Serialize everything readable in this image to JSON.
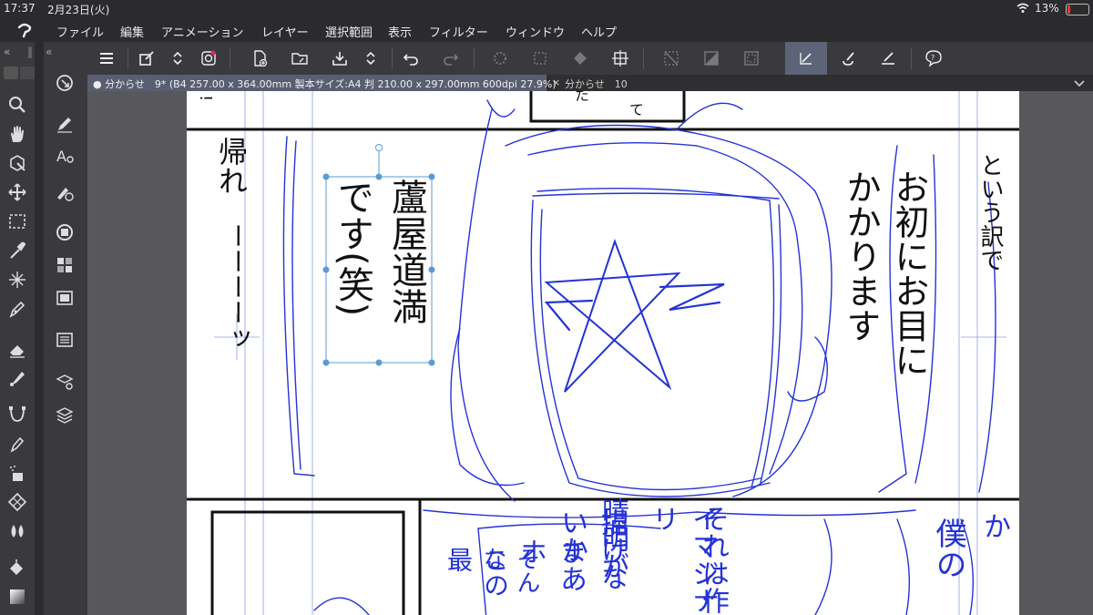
{
  "status": {
    "time": "17:37",
    "date": "2月23日(火)",
    "battery": "13%"
  },
  "menu": [
    "ファイル",
    "編集",
    "アニメーション",
    "レイヤー",
    "選択範囲",
    "表示",
    "フィルター",
    "ウィンドウ",
    "ヘルプ"
  ],
  "tabs": {
    "active_label": "● 分からせ　9* (B4 257.00 x 364.00mm 製本サイズ:A4 判 210.00 x 297.00mm 600dpi 27.9%)",
    "second_label": "分からせ　10",
    "close_glyph": "×"
  },
  "canvas_text": {
    "top_fragments": [
      "!",
      "た",
      "て"
    ],
    "kaere": "帰れ",
    "dash": "ーーーーッ",
    "selected_col1": "蘆屋道満",
    "selected_col2": "です(笑)",
    "ohatsu_col1": "お初にお目に",
    "ohatsu_col2": "かかります",
    "toiu": "という訳で",
    "bottom_col1": "それは作",
    "bottom_col2": "イマジナリ",
    "bottom_col3": "晴明が",
    "bottom_col4": "描けないか",
    "bottom_col5": "まあホ",
    "bottom_col6": "そんな",
    "bottom_col7": "この最",
    "bottom_right1": "というか",
    "bottom_right2": "僕の"
  },
  "colors": {
    "accent": "#5d6478",
    "sketch": "#2533d6",
    "canvas_bg": "#58585c"
  }
}
